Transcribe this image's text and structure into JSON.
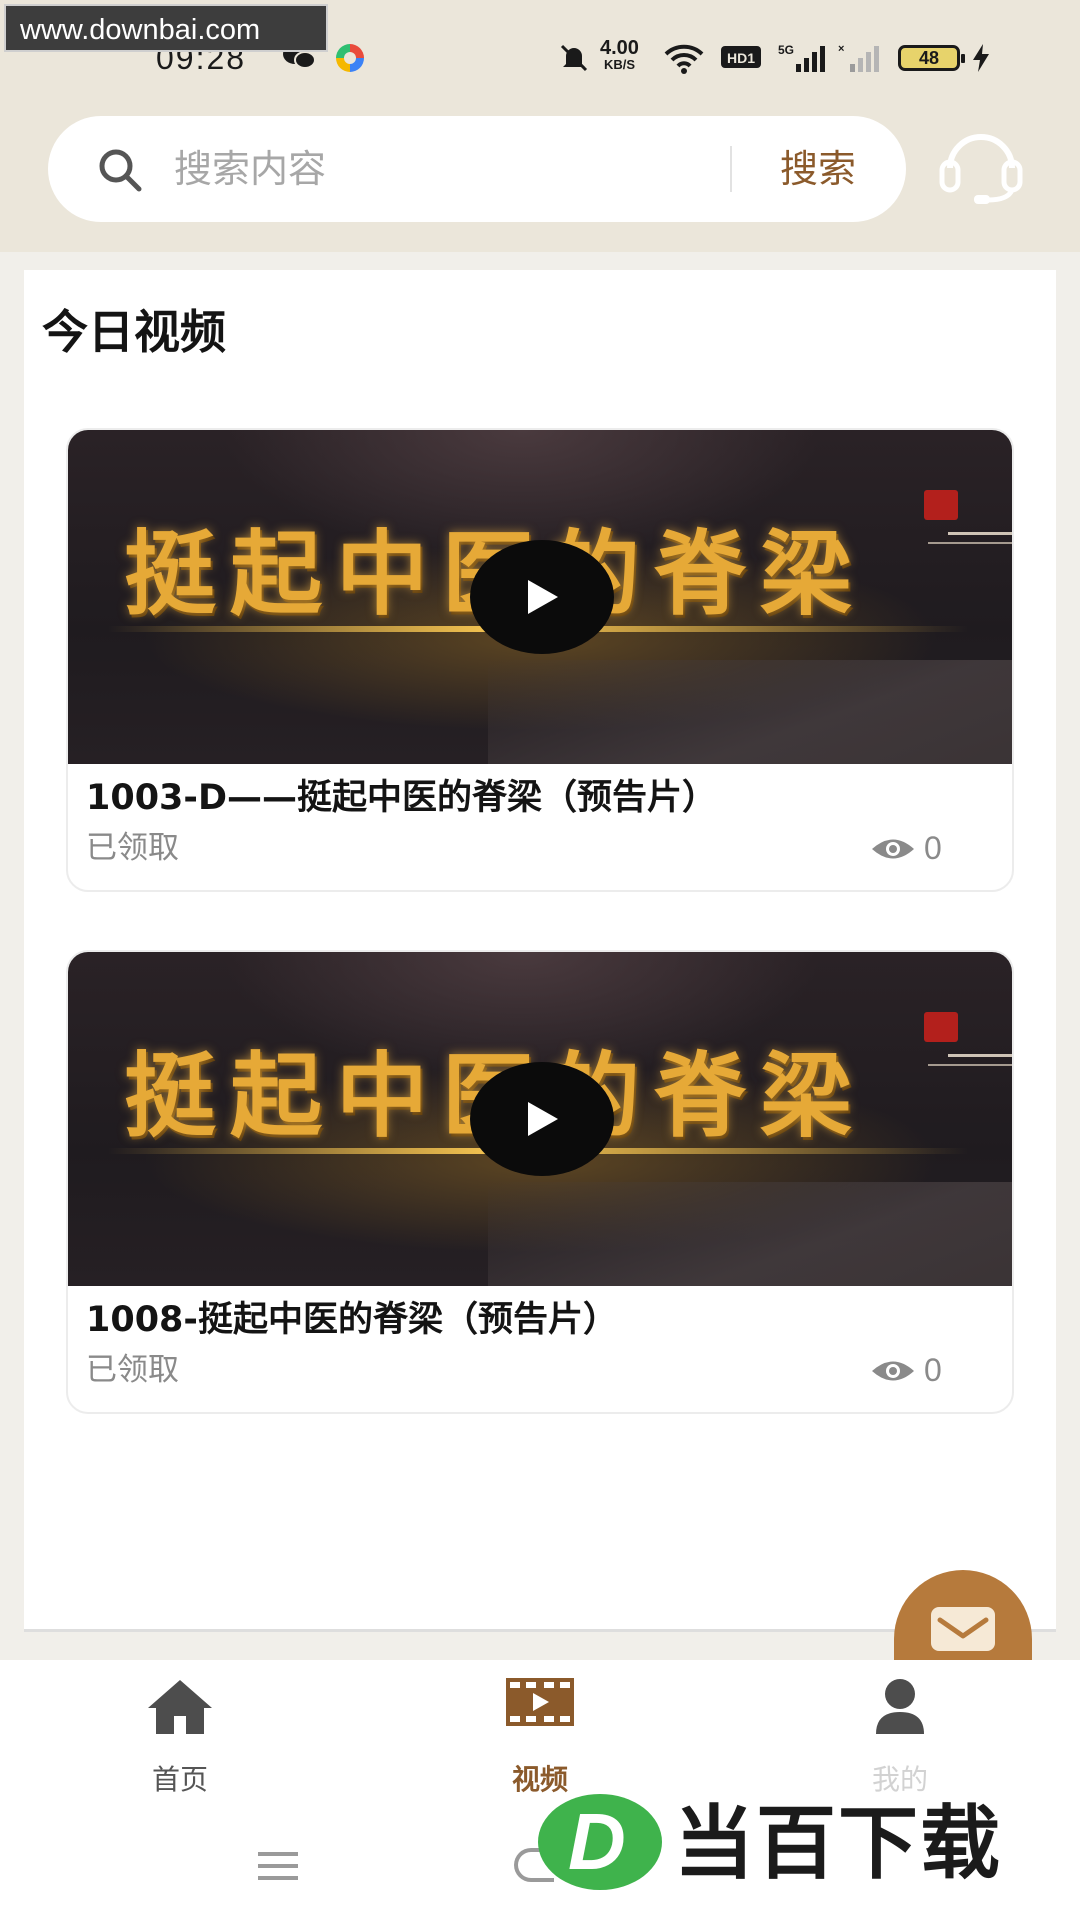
{
  "watermark": {
    "site": "www.downbai.com"
  },
  "status_bar": {
    "time": "09:28",
    "network_speed": "4.00",
    "network_speed_unit": "KB/S",
    "hd_label": "HD1",
    "signal_label": "5G",
    "battery": "48"
  },
  "search": {
    "placeholder": "搜索内容",
    "button_label": "搜索"
  },
  "section": {
    "title": "今日视频"
  },
  "videos": [
    {
      "title": "1003-D——挺起中医的脊梁（预告片）",
      "status": "已领取",
      "views": "0",
      "thumbnail_text": "挺起中医的脊梁"
    },
    {
      "title": "1008-挺起中医的脊梁（预告片）",
      "status": "已领取",
      "views": "0",
      "thumbnail_text": "挺起中医的脊梁"
    }
  ],
  "bottom_nav": {
    "items": [
      {
        "label": "首页",
        "icon": "home-icon"
      },
      {
        "label": "视频",
        "icon": "video-icon",
        "active": true
      },
      {
        "label": "我的",
        "icon": "user-icon"
      }
    ]
  },
  "brand": {
    "logo_letter": "D",
    "name": "当百下载"
  },
  "colors": {
    "accent": "#8b5a2b",
    "fab": "#b67a3c",
    "header_bg": "#ebe6da",
    "page_bg": "#f1efea"
  }
}
